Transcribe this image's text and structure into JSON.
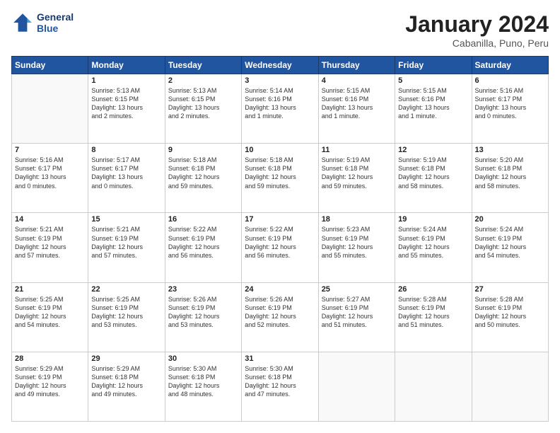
{
  "header": {
    "logo_line1": "General",
    "logo_line2": "Blue",
    "month": "January 2024",
    "location": "Cabanilla, Puno, Peru"
  },
  "weekdays": [
    "Sunday",
    "Monday",
    "Tuesday",
    "Wednesday",
    "Thursday",
    "Friday",
    "Saturday"
  ],
  "weeks": [
    [
      {
        "day": "",
        "info": ""
      },
      {
        "day": "1",
        "info": "Sunrise: 5:13 AM\nSunset: 6:15 PM\nDaylight: 13 hours\nand 2 minutes."
      },
      {
        "day": "2",
        "info": "Sunrise: 5:13 AM\nSunset: 6:15 PM\nDaylight: 13 hours\nand 2 minutes."
      },
      {
        "day": "3",
        "info": "Sunrise: 5:14 AM\nSunset: 6:16 PM\nDaylight: 13 hours\nand 1 minute."
      },
      {
        "day": "4",
        "info": "Sunrise: 5:15 AM\nSunset: 6:16 PM\nDaylight: 13 hours\nand 1 minute."
      },
      {
        "day": "5",
        "info": "Sunrise: 5:15 AM\nSunset: 6:16 PM\nDaylight: 13 hours\nand 1 minute."
      },
      {
        "day": "6",
        "info": "Sunrise: 5:16 AM\nSunset: 6:17 PM\nDaylight: 13 hours\nand 0 minutes."
      }
    ],
    [
      {
        "day": "7",
        "info": "Sunrise: 5:16 AM\nSunset: 6:17 PM\nDaylight: 13 hours\nand 0 minutes."
      },
      {
        "day": "8",
        "info": "Sunrise: 5:17 AM\nSunset: 6:17 PM\nDaylight: 13 hours\nand 0 minutes."
      },
      {
        "day": "9",
        "info": "Sunrise: 5:18 AM\nSunset: 6:18 PM\nDaylight: 12 hours\nand 59 minutes."
      },
      {
        "day": "10",
        "info": "Sunrise: 5:18 AM\nSunset: 6:18 PM\nDaylight: 12 hours\nand 59 minutes."
      },
      {
        "day": "11",
        "info": "Sunrise: 5:19 AM\nSunset: 6:18 PM\nDaylight: 12 hours\nand 59 minutes."
      },
      {
        "day": "12",
        "info": "Sunrise: 5:19 AM\nSunset: 6:18 PM\nDaylight: 12 hours\nand 58 minutes."
      },
      {
        "day": "13",
        "info": "Sunrise: 5:20 AM\nSunset: 6:18 PM\nDaylight: 12 hours\nand 58 minutes."
      }
    ],
    [
      {
        "day": "14",
        "info": "Sunrise: 5:21 AM\nSunset: 6:19 PM\nDaylight: 12 hours\nand 57 minutes."
      },
      {
        "day": "15",
        "info": "Sunrise: 5:21 AM\nSunset: 6:19 PM\nDaylight: 12 hours\nand 57 minutes."
      },
      {
        "day": "16",
        "info": "Sunrise: 5:22 AM\nSunset: 6:19 PM\nDaylight: 12 hours\nand 56 minutes."
      },
      {
        "day": "17",
        "info": "Sunrise: 5:22 AM\nSunset: 6:19 PM\nDaylight: 12 hours\nand 56 minutes."
      },
      {
        "day": "18",
        "info": "Sunrise: 5:23 AM\nSunset: 6:19 PM\nDaylight: 12 hours\nand 55 minutes."
      },
      {
        "day": "19",
        "info": "Sunrise: 5:24 AM\nSunset: 6:19 PM\nDaylight: 12 hours\nand 55 minutes."
      },
      {
        "day": "20",
        "info": "Sunrise: 5:24 AM\nSunset: 6:19 PM\nDaylight: 12 hours\nand 54 minutes."
      }
    ],
    [
      {
        "day": "21",
        "info": "Sunrise: 5:25 AM\nSunset: 6:19 PM\nDaylight: 12 hours\nand 54 minutes."
      },
      {
        "day": "22",
        "info": "Sunrise: 5:25 AM\nSunset: 6:19 PM\nDaylight: 12 hours\nand 53 minutes."
      },
      {
        "day": "23",
        "info": "Sunrise: 5:26 AM\nSunset: 6:19 PM\nDaylight: 12 hours\nand 53 minutes."
      },
      {
        "day": "24",
        "info": "Sunrise: 5:26 AM\nSunset: 6:19 PM\nDaylight: 12 hours\nand 52 minutes."
      },
      {
        "day": "25",
        "info": "Sunrise: 5:27 AM\nSunset: 6:19 PM\nDaylight: 12 hours\nand 51 minutes."
      },
      {
        "day": "26",
        "info": "Sunrise: 5:28 AM\nSunset: 6:19 PM\nDaylight: 12 hours\nand 51 minutes."
      },
      {
        "day": "27",
        "info": "Sunrise: 5:28 AM\nSunset: 6:19 PM\nDaylight: 12 hours\nand 50 minutes."
      }
    ],
    [
      {
        "day": "28",
        "info": "Sunrise: 5:29 AM\nSunset: 6:19 PM\nDaylight: 12 hours\nand 49 minutes."
      },
      {
        "day": "29",
        "info": "Sunrise: 5:29 AM\nSunset: 6:18 PM\nDaylight: 12 hours\nand 49 minutes."
      },
      {
        "day": "30",
        "info": "Sunrise: 5:30 AM\nSunset: 6:18 PM\nDaylight: 12 hours\nand 48 minutes."
      },
      {
        "day": "31",
        "info": "Sunrise: 5:30 AM\nSunset: 6:18 PM\nDaylight: 12 hours\nand 47 minutes."
      },
      {
        "day": "",
        "info": ""
      },
      {
        "day": "",
        "info": ""
      },
      {
        "day": "",
        "info": ""
      }
    ]
  ]
}
